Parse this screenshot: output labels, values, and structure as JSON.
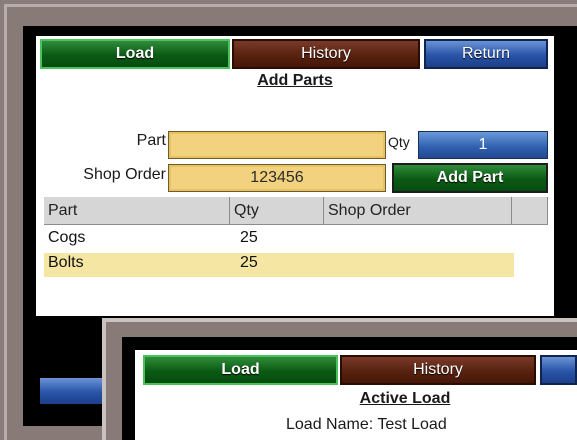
{
  "window1": {
    "tabs": {
      "load": "Load",
      "history": "History",
      "return": "Return"
    },
    "heading": "Add Parts",
    "form": {
      "part_label": "Part",
      "part_value": "",
      "qty_label": "Qty",
      "qty_value": "1",
      "shop_order_label": "Shop Order",
      "shop_order_value": "123456",
      "add_part_button": "Add Part"
    },
    "table": {
      "columns": [
        "Part",
        "Qty",
        "Shop Order"
      ],
      "rows": [
        {
          "part": "Cogs",
          "qty": "25",
          "shop_order": ""
        },
        {
          "part": "Bolts",
          "qty": "25",
          "shop_order": ""
        }
      ]
    }
  },
  "window2": {
    "tabs": {
      "load": "Load",
      "history": "History"
    },
    "heading": "Active Load",
    "load_name_label": "Load Name:",
    "load_name_value": "Test Load"
  },
  "colors": {
    "tab_green": "#0b5a14",
    "tab_brown": "#58220f",
    "tab_blue": "#2954a8",
    "field_yellow": "#f2d27e",
    "row_highlight": "#f6e6a3"
  }
}
